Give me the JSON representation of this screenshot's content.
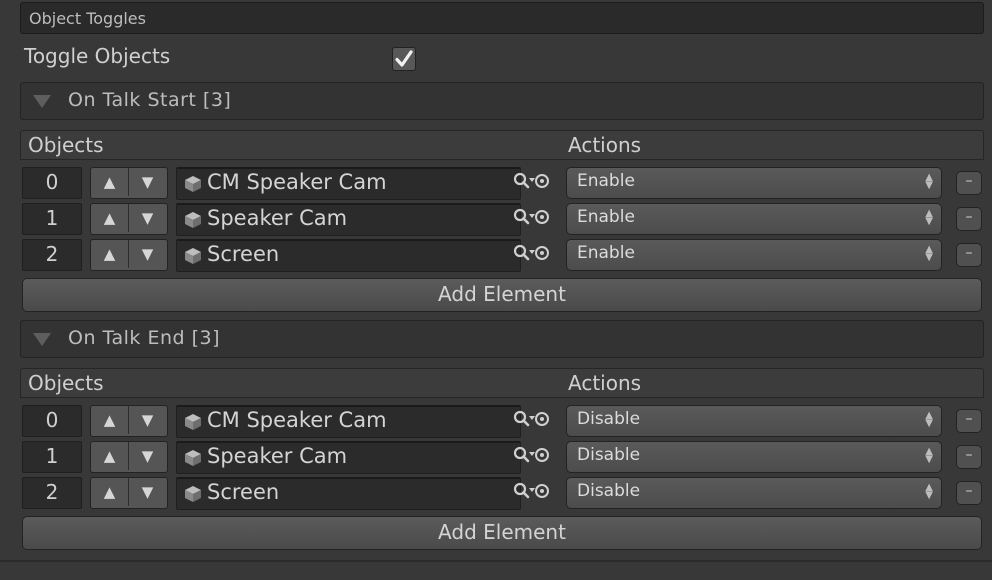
{
  "section_header": "Object Toggles",
  "toggle": {
    "label": "Toggle Objects",
    "checked": true
  },
  "lists": [
    {
      "title": "On Talk Start [3]",
      "col_objects": "Objects",
      "col_actions": "Actions",
      "rows": [
        {
          "index": "0",
          "object": "CM Speaker Cam",
          "action": "Enable"
        },
        {
          "index": "1",
          "object": "Speaker Cam",
          "action": "Enable"
        },
        {
          "index": "2",
          "object": "Screen",
          "action": "Enable"
        }
      ],
      "add_label": "Add Element"
    },
    {
      "title": "On Talk End [3]",
      "col_objects": "Objects",
      "col_actions": "Actions",
      "rows": [
        {
          "index": "0",
          "object": "CM Speaker Cam",
          "action": "Disable"
        },
        {
          "index": "1",
          "object": "Speaker Cam",
          "action": "Disable"
        },
        {
          "index": "2",
          "object": "Screen",
          "action": "Disable"
        }
      ],
      "add_label": "Add Element"
    }
  ],
  "buttons": {
    "up": "▲",
    "down": "▼",
    "remove": "–"
  },
  "icons": {
    "foldout": "triangle-down-icon",
    "object": "cube-icon",
    "picker": "object-picker-icon",
    "checkbox": "checkmark-icon"
  },
  "colors": {
    "background": "#383838",
    "field": "#2b2b2b",
    "button": "#555555",
    "text": "#d4d4d4"
  }
}
